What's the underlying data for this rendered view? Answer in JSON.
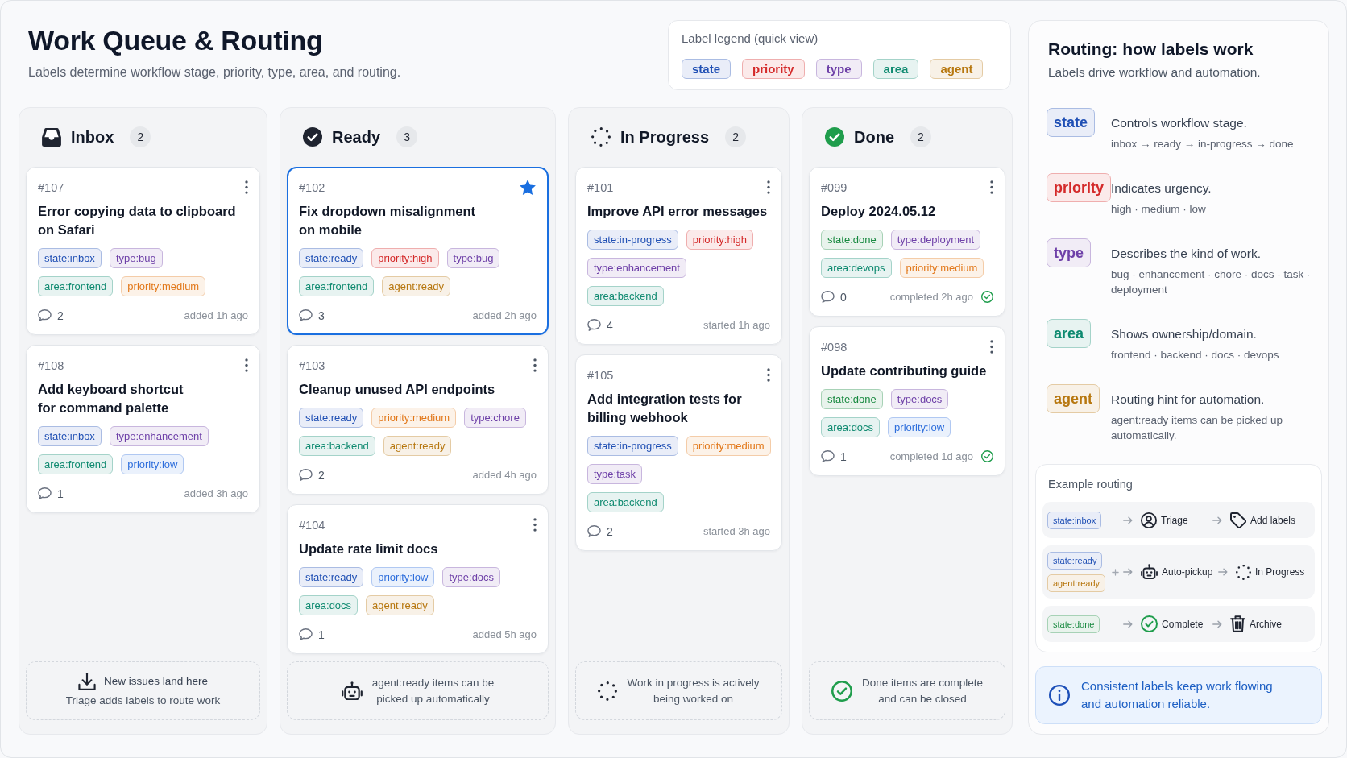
{
  "header": {
    "title": "Work Queue & Routing",
    "subtitle": "Labels determine workflow stage, priority, type, area, and routing."
  },
  "legend": {
    "title": "Label legend (quick view)",
    "labels": [
      {
        "text": "state",
        "color": "#1f4fb4"
      },
      {
        "text": "priority",
        "color": "#d42a2a"
      },
      {
        "text": "type",
        "color": "#6e40a8"
      },
      {
        "text": "area",
        "color": "#0f8a70"
      },
      {
        "text": "agent",
        "color": "#b7770f"
      }
    ]
  },
  "columns": [
    {
      "kind": "inbox",
      "title": "Inbox",
      "count": "2",
      "cards": [
        {
          "id": "#107",
          "title": "Error copying data to clipboard\non Safari",
          "selected": false,
          "starred": false,
          "tag_rows": [
            [
              {
                "text": "state:inbox",
                "color": "#1f4fb4"
              },
              {
                "text": "type:bug",
                "color": "#6e40a8"
              }
            ],
            [
              {
                "text": "area:frontend",
                "color": "#0f8a70"
              },
              {
                "text": "priority:medium",
                "color": "#e2781a"
              }
            ]
          ],
          "comments": "2",
          "meta": "added 1h ago",
          "completed": false
        },
        {
          "id": "#108",
          "title": "Add keyboard shortcut\nfor command palette",
          "selected": false,
          "starred": false,
          "tag_rows": [
            [
              {
                "text": "state:inbox",
                "color": "#1f4fb4"
              },
              {
                "text": "type:enhancement",
                "color": "#6e40a8"
              }
            ],
            [
              {
                "text": "area:frontend",
                "color": "#0f8a70"
              },
              {
                "text": "priority:low",
                "color": "#2f6fdc"
              }
            ]
          ],
          "comments": "1",
          "meta": "added 3h ago",
          "completed": false
        }
      ],
      "note": {
        "title": "New issues land here",
        "text": "Triage adds labels to route work"
      }
    },
    {
      "kind": "ready",
      "title": "Ready",
      "count": "3",
      "cards": [
        {
          "id": "#102",
          "title": "Fix dropdown misalignment\non mobile",
          "selected": true,
          "starred": true,
          "tag_rows": [
            [
              {
                "text": "state:ready",
                "color": "#1f4fb4"
              },
              {
                "text": "priority:high",
                "color": "#d42a2a"
              },
              {
                "text": "type:bug",
                "color": "#6e40a8"
              }
            ],
            [
              {
                "text": "area:frontend",
                "color": "#0f8a70"
              },
              {
                "text": "agent:ready",
                "color": "#b7770f"
              }
            ]
          ],
          "comments": "3",
          "meta": "added 2h ago",
          "completed": false
        },
        {
          "id": "#103",
          "title": "Cleanup unused API endpoints",
          "selected": false,
          "starred": false,
          "tag_rows": [
            [
              {
                "text": "state:ready",
                "color": "#1f4fb4"
              },
              {
                "text": "priority:medium",
                "color": "#e2781a"
              },
              {
                "text": "type:chore",
                "color": "#6e40a8"
              }
            ],
            [
              {
                "text": "area:backend",
                "color": "#0f8a70"
              },
              {
                "text": "agent:ready",
                "color": "#b7770f"
              }
            ]
          ],
          "comments": "2",
          "meta": "added 4h ago",
          "completed": false
        },
        {
          "id": "#104",
          "title": "Update rate limit docs",
          "selected": false,
          "starred": false,
          "tag_rows": [
            [
              {
                "text": "state:ready",
                "color": "#1f4fb4"
              },
              {
                "text": "priority:low",
                "color": "#2f6fdc"
              },
              {
                "text": "type:docs",
                "color": "#6e40a8"
              }
            ],
            [
              {
                "text": "area:docs",
                "color": "#0f8a70"
              },
              {
                "text": "agent:ready",
                "color": "#b7770f"
              }
            ]
          ],
          "comments": "1",
          "meta": "added 5h ago",
          "completed": false
        }
      ],
      "note": {
        "text": "agent:ready items can be\npicked up automatically"
      }
    },
    {
      "kind": "progress",
      "title": "In Progress",
      "count": "2",
      "cards": [
        {
          "id": "#101",
          "title": "Improve API error messages",
          "selected": false,
          "starred": false,
          "tag_rows": [
            [
              {
                "text": "state:in-progress",
                "color": "#1f4fb4"
              },
              {
                "text": "priority:high",
                "color": "#d42a2a"
              }
            ],
            [
              {
                "text": "type:enhancement",
                "color": "#6e40a8"
              }
            ],
            [
              {
                "text": "area:backend",
                "color": "#0f8a70"
              }
            ]
          ],
          "comments": "4",
          "meta": "started 1h ago",
          "completed": false
        },
        {
          "id": "#105",
          "title": "Add integration tests for\nbilling webhook",
          "selected": false,
          "starred": false,
          "tag_rows": [
            [
              {
                "text": "state:in-progress",
                "color": "#1f4fb4"
              },
              {
                "text": "priority:medium",
                "color": "#e2781a"
              }
            ],
            [
              {
                "text": "type:task",
                "color": "#6e40a8"
              }
            ],
            [
              {
                "text": "area:backend",
                "color": "#0f8a70"
              }
            ]
          ],
          "comments": "2",
          "meta": "started 3h ago",
          "completed": false
        }
      ],
      "note": {
        "text": "Work in progress is actively\nbeing worked on"
      }
    },
    {
      "kind": "done",
      "title": "Done",
      "count": "2",
      "cards": [
        {
          "id": "#099",
          "title": "Deploy 2024.05.12",
          "selected": false,
          "starred": false,
          "tag_rows": [
            [
              {
                "text": "state:done",
                "color": "#17893f"
              },
              {
                "text": "type:deployment",
                "color": "#6e40a8"
              }
            ],
            [
              {
                "text": "area:devops",
                "color": "#0f8a70"
              },
              {
                "text": "priority:medium",
                "color": "#e2781a"
              }
            ]
          ],
          "comments": "0",
          "meta": "completed 2h ago",
          "completed": true
        },
        {
          "id": "#098",
          "title": "Update contributing guide",
          "selected": false,
          "starred": false,
          "tag_rows": [
            [
              {
                "text": "state:done",
                "color": "#17893f"
              },
              {
                "text": "type:docs",
                "color": "#6e40a8"
              }
            ],
            [
              {
                "text": "area:docs",
                "color": "#0f8a70"
              },
              {
                "text": "priority:low",
                "color": "#2f6fdc"
              }
            ]
          ],
          "comments": "1",
          "meta": "completed 1d ago",
          "completed": true
        }
      ],
      "note": {
        "text": "Done items are complete\nand can be closed"
      }
    }
  ],
  "routing": {
    "title": "Routing: how labels work",
    "subtitle": "Labels drive workflow and automation.",
    "guide": [
      {
        "label": "state",
        "color": "#1f4fb4",
        "description": "Controls workflow stage.",
        "values": "inbox → ready → in-progress → done"
      },
      {
        "label": "priority",
        "color": "#d42a2a",
        "description": "Indicates urgency.",
        "values": "high · medium · low"
      },
      {
        "label": "type",
        "color": "#6e40a8",
        "description": "Describes the kind of work.",
        "values": "bug · enhancement · chore · docs · task · deployment"
      },
      {
        "label": "area",
        "color": "#0f8a70",
        "description": "Shows ownership/domain.",
        "values": "frontend · backend · docs · devops"
      },
      {
        "label": "agent",
        "color": "#b7770f",
        "description": "Routing hint for automation.",
        "values": "agent:ready items can be picked up automatically."
      }
    ],
    "example": {
      "title": "Example routing",
      "rows": [
        {
          "labels": [
            {
              "text": "state:inbox",
              "color": "#1f4fb4"
            }
          ],
          "steps": [
            {
              "kind": "triage",
              "text": "Triage"
            },
            {
              "kind": "label",
              "text": "Add labels"
            }
          ]
        },
        {
          "labels": [
            {
              "text": "state:ready",
              "color": "#1f4fb4"
            },
            {
              "text": "agent:ready",
              "color": "#b7770f"
            }
          ],
          "steps": [
            {
              "kind": "pickup",
              "text": "Auto-pickup"
            },
            {
              "kind": "progress",
              "text": "In Progress"
            }
          ]
        },
        {
          "labels": [
            {
              "text": "state:done",
              "color": "#17893f"
            }
          ],
          "steps": [
            {
              "kind": "complete",
              "text": "Complete"
            },
            {
              "kind": "archive",
              "text": "Archive"
            }
          ]
        }
      ]
    },
    "tip": "Consistent labels keep work flowing\nand automation reliable."
  }
}
